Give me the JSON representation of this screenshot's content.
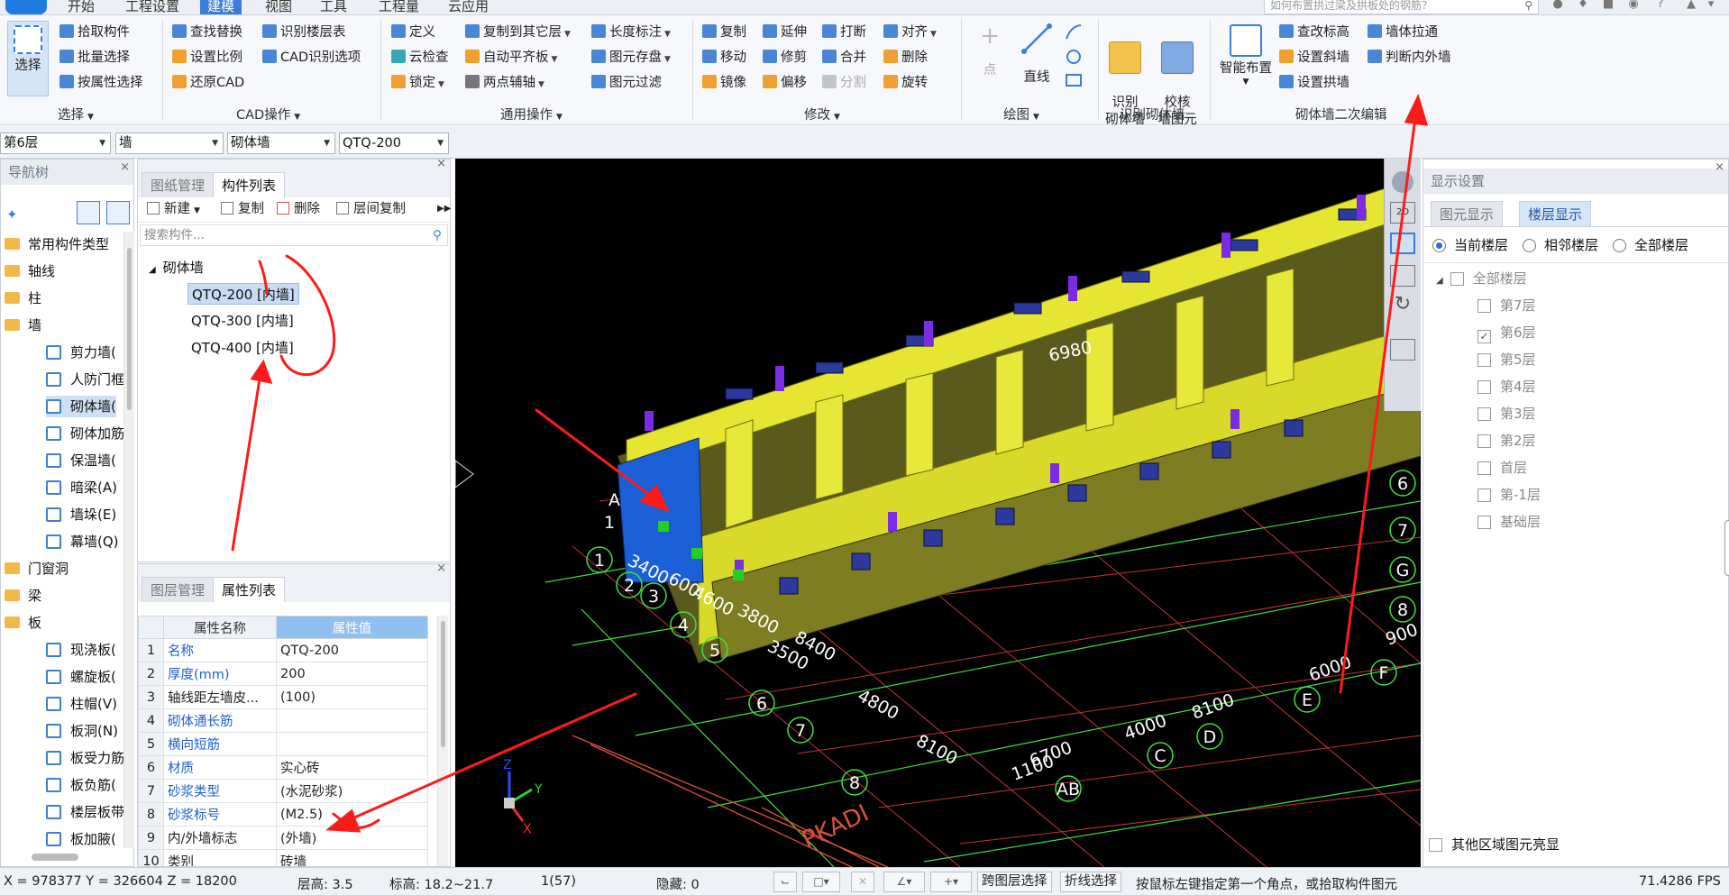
{
  "menubar": {
    "tabs": [
      "开始",
      "工程设置",
      "建模",
      "视图",
      "工具",
      "工程量",
      "云应用"
    ],
    "active_tab": "建模",
    "search_placeholder": "如何布置拱过梁及拱板处的钢筋?"
  },
  "ribbon": {
    "select_group": {
      "big_button": "选择",
      "items": [
        "拾取构件",
        "批量选择",
        "按属性选择"
      ],
      "label": "选择"
    },
    "cad_group": {
      "items": [
        "查找替换",
        "识别楼层表",
        "设置比例",
        "CAD识别选项",
        "还原CAD"
      ],
      "label": "CAD操作"
    },
    "common_group": {
      "items": [
        "定义",
        "复制到其它层",
        "长度标注",
        "云检查",
        "自动平齐板",
        "图元存盘",
        "锁定",
        "两点辅轴",
        "图元过滤"
      ],
      "label": "通用操作"
    },
    "modify_group": {
      "items": [
        "复制",
        "延伸",
        "打断",
        "对齐",
        "移动",
        "修剪",
        "合并",
        "删除",
        "镜像",
        "偏移",
        "分割",
        "旋转"
      ],
      "label": "修改"
    },
    "draw_group": {
      "items": [
        "点",
        "直线"
      ],
      "label": "绘图"
    },
    "identify_group": {
      "items": [
        "识别\n砌体墙",
        "校核\n墙图元"
      ],
      "label": "识别砌体墙"
    },
    "edit2_group": {
      "big_button": "智能布置",
      "items": [
        "查改标高",
        "墙体拉通",
        "设置斜墙",
        "判断内外墙",
        "设置拱墙"
      ],
      "label": "砌体墙二次编辑"
    }
  },
  "selectors": [
    "第6层",
    "墙",
    "砌体墙",
    "QTQ-200"
  ],
  "nav_tree": {
    "title": "导航树",
    "items": [
      {
        "label": "常用构件类型",
        "type": "folder"
      },
      {
        "label": "轴线",
        "type": "folder"
      },
      {
        "label": "柱",
        "type": "folder"
      },
      {
        "label": "墙",
        "type": "folder"
      },
      {
        "label": "剪力墙(",
        "type": "child"
      },
      {
        "label": "人防门框",
        "type": "child"
      },
      {
        "label": "砌体墙(",
        "type": "child",
        "selected": true
      },
      {
        "label": "砌体加筋",
        "type": "child"
      },
      {
        "label": "保温墙(",
        "type": "child"
      },
      {
        "label": "暗梁(A)",
        "type": "child"
      },
      {
        "label": "墙垛(E)",
        "type": "child"
      },
      {
        "label": "幕墙(Q)",
        "type": "child"
      },
      {
        "label": "门窗洞",
        "type": "folder"
      },
      {
        "label": "梁",
        "type": "folder"
      },
      {
        "label": "板",
        "type": "folder"
      },
      {
        "label": "现浇板(",
        "type": "child"
      },
      {
        "label": "螺旋板(",
        "type": "child"
      },
      {
        "label": "柱帽(V)",
        "type": "child"
      },
      {
        "label": "板洞(N)",
        "type": "child"
      },
      {
        "label": "板受力筋",
        "type": "child"
      },
      {
        "label": "板负筋(",
        "type": "child"
      },
      {
        "label": "楼层板带",
        "type": "child"
      },
      {
        "label": "板加腋(",
        "type": "child"
      }
    ]
  },
  "component_panel": {
    "tabs": [
      "图纸管理",
      "构件列表"
    ],
    "active_tab": "构件列表",
    "toolbar": [
      "新建",
      "复制",
      "删除",
      "层间复制"
    ],
    "search_placeholder": "搜索构件...",
    "root": "砌体墙",
    "items": [
      "QTQ-200 [内墙]",
      "QTQ-300 [内墙]",
      "QTQ-400 [内墙]"
    ]
  },
  "property_panel": {
    "tabs": [
      "图层管理",
      "属性列表"
    ],
    "active_tab": "属性列表",
    "headers": [
      "属性名称",
      "属性值"
    ],
    "rows": [
      {
        "n": "1",
        "name": "名称",
        "value": "QTQ-200",
        "blue": true
      },
      {
        "n": "2",
        "name": "厚度(mm)",
        "value": "200",
        "blue": true
      },
      {
        "n": "3",
        "name": "轴线距左墙皮...",
        "value": "(100)",
        "blue": false
      },
      {
        "n": "4",
        "name": "砌体通长筋",
        "value": "",
        "blue": true
      },
      {
        "n": "5",
        "name": "横向短筋",
        "value": "",
        "blue": true
      },
      {
        "n": "6",
        "name": "材质",
        "value": "实心砖",
        "blue": true
      },
      {
        "n": "7",
        "name": "砂浆类型",
        "value": "(水泥砂浆)",
        "blue": true
      },
      {
        "n": "8",
        "name": "砂浆标号",
        "value": "(M2.5)",
        "blue": true
      },
      {
        "n": "9",
        "name": "内/外墙标志",
        "value": "(外墙)",
        "blue": false
      },
      {
        "n": "10",
        "name": "类别",
        "value": "砖墙",
        "blue": false
      }
    ]
  },
  "viewport": {
    "dims_left": [
      "3400",
      "600",
      "4600",
      "3800",
      "8400",
      "3500",
      "4800",
      "8100"
    ],
    "dims_bottom": [
      "1100",
      "6700",
      "4000",
      "8100",
      "6000",
      "900"
    ],
    "dim_top": "6980",
    "axes_left": [
      "1",
      "2",
      "3",
      "4",
      "5",
      "6",
      "7",
      "8"
    ],
    "axes_bottom": [
      "AB",
      "C",
      "D",
      "E",
      "F"
    ],
    "axes_right": [
      "6",
      "7",
      "G",
      "8"
    ],
    "axis_a": "A",
    "axis_1": "1",
    "stamp": "PKADI",
    "view_scale": "2D"
  },
  "display_panel": {
    "title": "显示设置",
    "tabs": [
      "图元显示",
      "楼层显示"
    ],
    "active_tab": "楼层显示",
    "radios": [
      {
        "label": "当前楼层",
        "on": true
      },
      {
        "label": "相邻楼层",
        "on": false
      },
      {
        "label": "全部楼层",
        "on": false
      }
    ],
    "all_floors": "全部楼层",
    "floors": [
      {
        "label": "第7层",
        "checked": false
      },
      {
        "label": "第6层",
        "checked": true
      },
      {
        "label": "第5层",
        "checked": false
      },
      {
        "label": "第4层",
        "checked": false
      },
      {
        "label": "第3层",
        "checked": false
      },
      {
        "label": "第2层",
        "checked": false
      },
      {
        "label": "首层",
        "checked": false
      },
      {
        "label": "第-1层",
        "checked": false
      },
      {
        "label": "基础层",
        "checked": false
      }
    ],
    "highlight_option": "其他区域图元亮显"
  },
  "statusbar": {
    "coords": "X = 978377 Y = 326604 Z = 18200",
    "floor_height": "层高:  3.5",
    "elevation": "标高:  18.2~21.7",
    "count": "1(57)",
    "hidden": "隐藏:  0",
    "btn_cross_layer": "跨图层选择",
    "btn_polyline": "折线选择",
    "hint": "按鼠标左键指定第一个角点，或拾取构件图元",
    "fps": "71.4286 FPS"
  },
  "colors": {
    "accent": "#3b7ed8",
    "wall_yellow": "#e6e632",
    "annotation": "#ff2020"
  }
}
